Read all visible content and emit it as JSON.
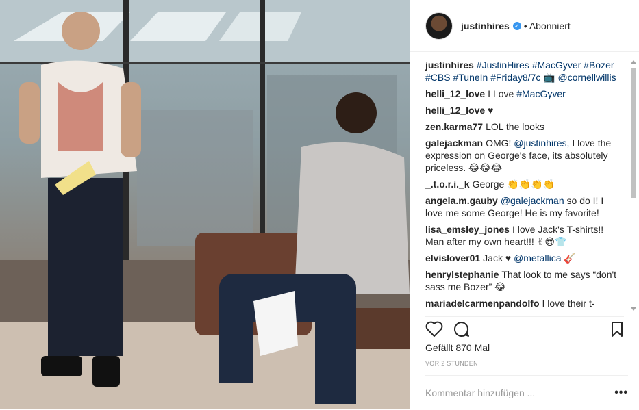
{
  "header": {
    "username": "justinhires",
    "follow_state": "Abonniert"
  },
  "caption": {
    "user": "justinhires",
    "text": "#JustinHires #MacGyver #Bozer #CBS #TuneIn #Friday8/7c 📺 @cornellwillis"
  },
  "comments": [
    {
      "user": "helli_12_love",
      "text": "I Love #MacGyver"
    },
    {
      "user": "helli_12_love",
      "text": "♥"
    },
    {
      "user": "zen.karma77",
      "text": "LOL the looks"
    },
    {
      "user": "galejackman",
      "text": "OMG! @justinhires, I love the expression on George's face, its absolutely priceless. 😂😂😂"
    },
    {
      "user": "_.t.o.r.i._k",
      "text": "George 👏👏👏👏"
    },
    {
      "user": "angela.m.gauby",
      "text": "@galejackman so do I! I love me some George! He is my favorite!"
    },
    {
      "user": "lisa_emsley_jones",
      "text": "I love Jack's T-shirts!! Man after my own heart!!! ✌😎👕"
    },
    {
      "user": "elvislover01",
      "text": "Jack ♥ @metallica 🎸"
    },
    {
      "user": "henrylstephanie",
      "text": "That look to me says “don't sass me Bozer” 😂"
    },
    {
      "user": "mariadelcarmenpandolfo",
      "text": "I love their t-"
    }
  ],
  "likes": "Gefällt 870 Mal",
  "timestamp": "VOR 2 STUNDEN",
  "comment_input": {
    "placeholder": "Kommentar hinzufügen ..."
  },
  "more_label": "•••",
  "colors": {
    "link": "#003569",
    "verified": "#3897f0",
    "muted": "#999999",
    "text": "#262626"
  },
  "icons": [
    "verified-badge-icon",
    "heart-icon",
    "comment-bubble-icon",
    "bookmark-icon"
  ]
}
